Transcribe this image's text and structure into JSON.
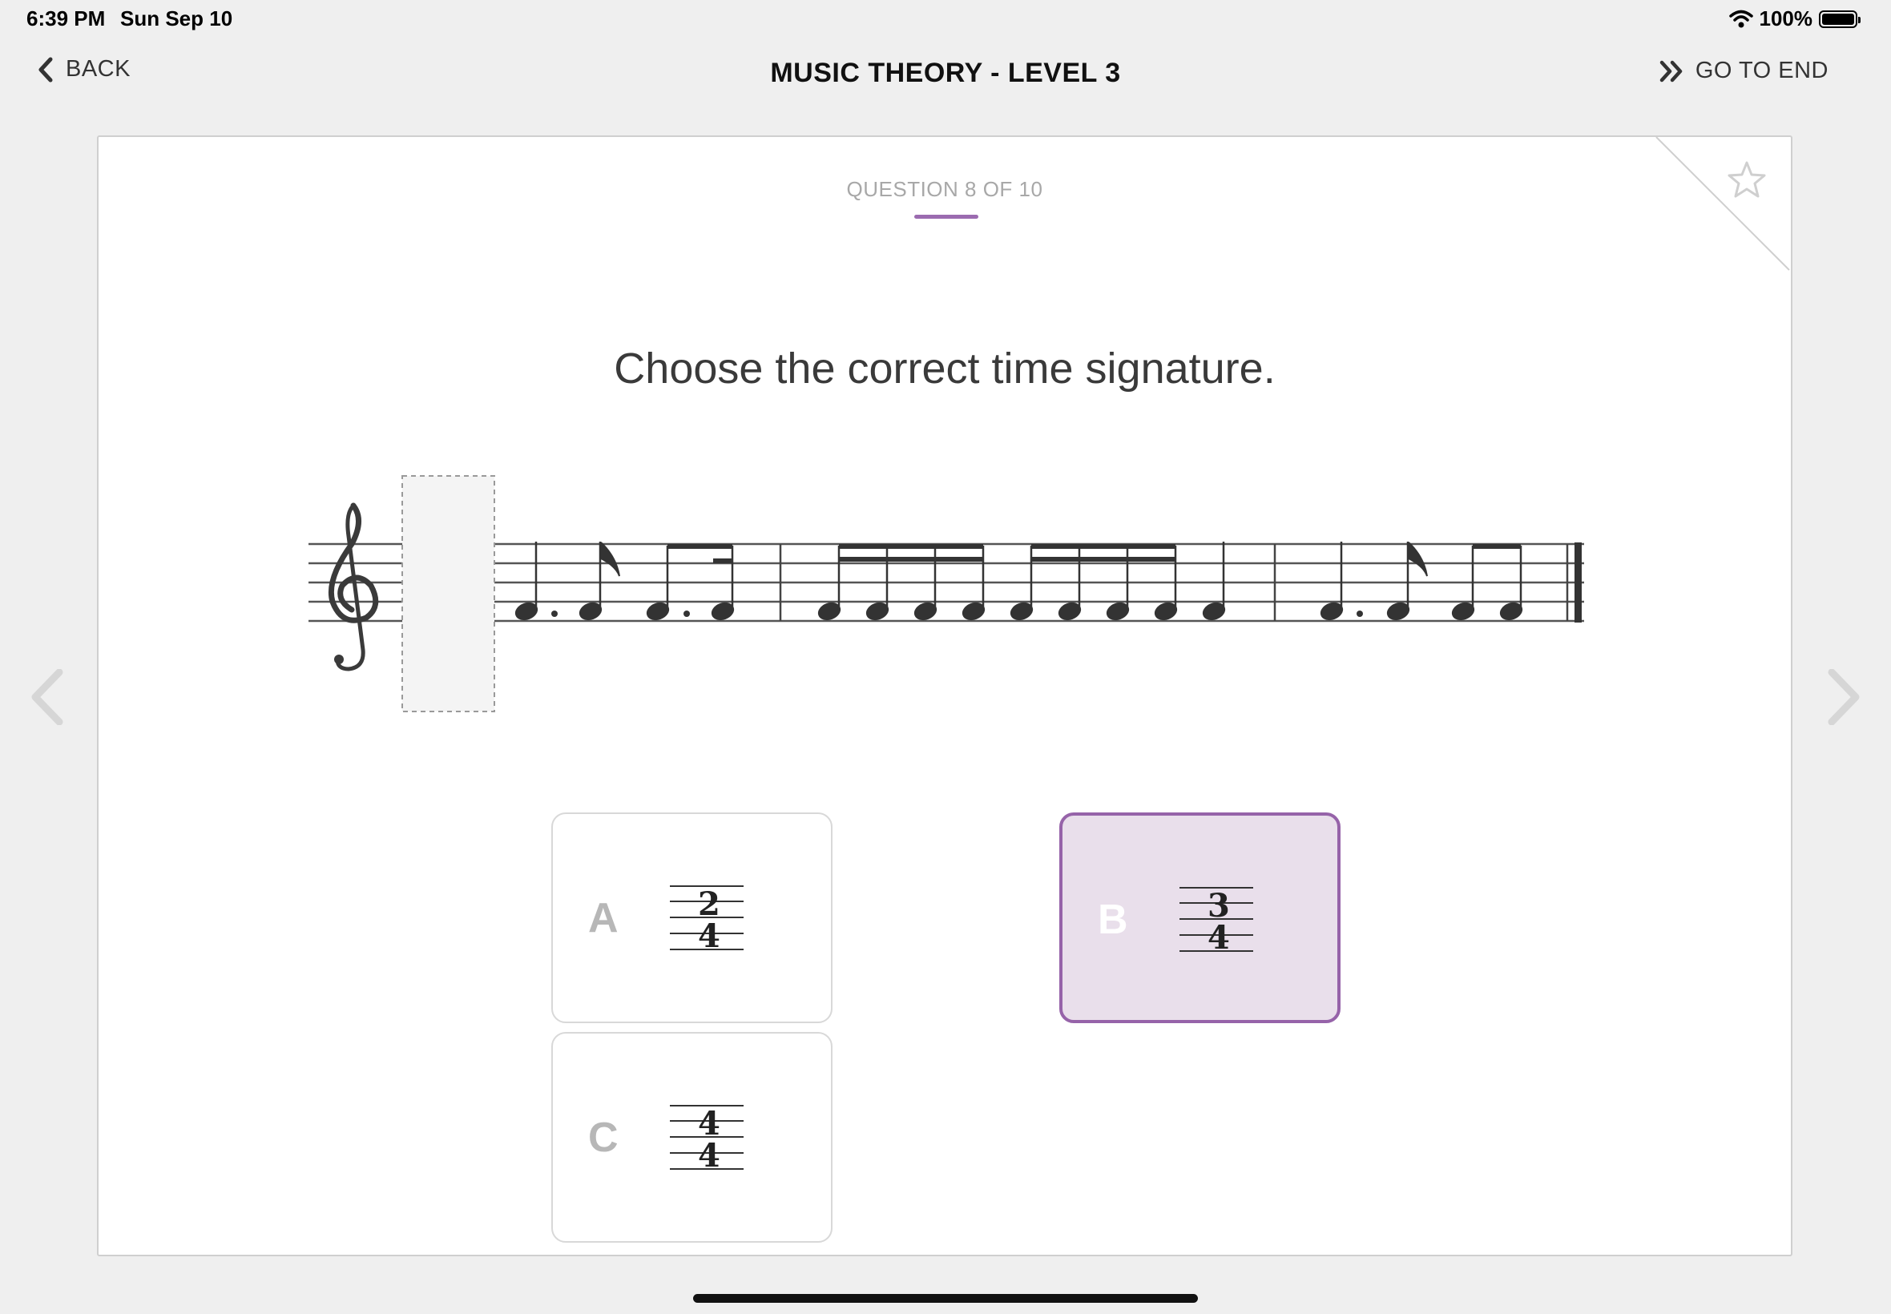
{
  "status_bar": {
    "time": "6:39 PM",
    "date": "Sun Sep 10",
    "battery": "100%"
  },
  "nav": {
    "back_label": "BACK",
    "title": "MUSIC THEORY - LEVEL 3",
    "go_to_end_label": "GO TO END"
  },
  "question": {
    "counter": "QUESTION 8 OF 10",
    "prompt": "Choose the correct time signature."
  },
  "answers": [
    {
      "letter": "A",
      "top": "2",
      "bottom": "4",
      "selected": false
    },
    {
      "letter": "B",
      "top": "3",
      "bottom": "4",
      "selected": true
    },
    {
      "letter": "C",
      "top": "4",
      "bottom": "4",
      "selected": false
    }
  ],
  "icons": [
    "chevron-left-icon",
    "double-chevron-right-icon",
    "star-icon",
    "wifi-icon",
    "battery-icon",
    "treble-clef-icon"
  ],
  "colors": {
    "accent": "#9663a9",
    "selected_bg": "#e9dfeb"
  }
}
